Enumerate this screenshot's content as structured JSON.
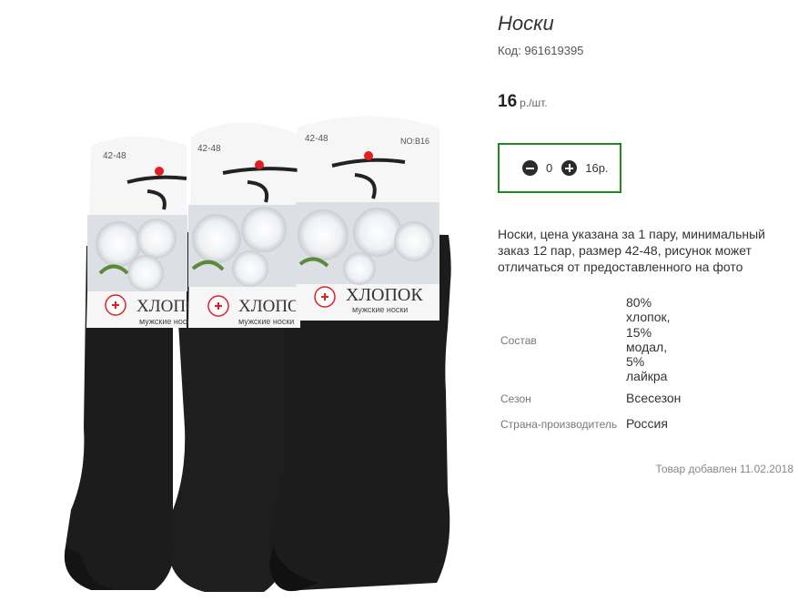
{
  "product": {
    "title": "Носки",
    "code_label": "Код:",
    "code": "961619395",
    "price": "16",
    "price_unit": "р./шт.",
    "quantity": "0",
    "total": "16р.",
    "description": "Носки, цена указана за 1 пару, минимальный заказ 12 пар, размер 42-48, рисунок может отличаться от предоставленного на фото",
    "specs": [
      {
        "label": "Состав",
        "value": [
          "80%",
          "хлопок,",
          "15%",
          "модал,",
          "5%",
          "лайкра"
        ]
      },
      {
        "label": "Сезон",
        "value": "Всесезон"
      },
      {
        "label": "Страна-производитель",
        "value": "Россия"
      }
    ],
    "added_label": "Товар добавлен",
    "added_date": "11.02.2018"
  },
  "image": {
    "tags": [
      {
        "size": "42-48",
        "model": "",
        "brand": "ХЛОПОК",
        "sub": "мужские носки"
      },
      {
        "size": "42-48",
        "model": "",
        "brand": "ХЛОПОК",
        "sub": "мужские носки"
      },
      {
        "size": "42-48",
        "model": "NO:B16",
        "brand": "ХЛОПОК",
        "sub": "мужские носки"
      }
    ]
  },
  "colors": {
    "accent": "#1e8a1e",
    "sock": "#1c1c1c",
    "logo_red": "#e31e24"
  },
  "icons": {
    "minus": "minus-circle-icon",
    "plus": "plus-circle-icon"
  }
}
